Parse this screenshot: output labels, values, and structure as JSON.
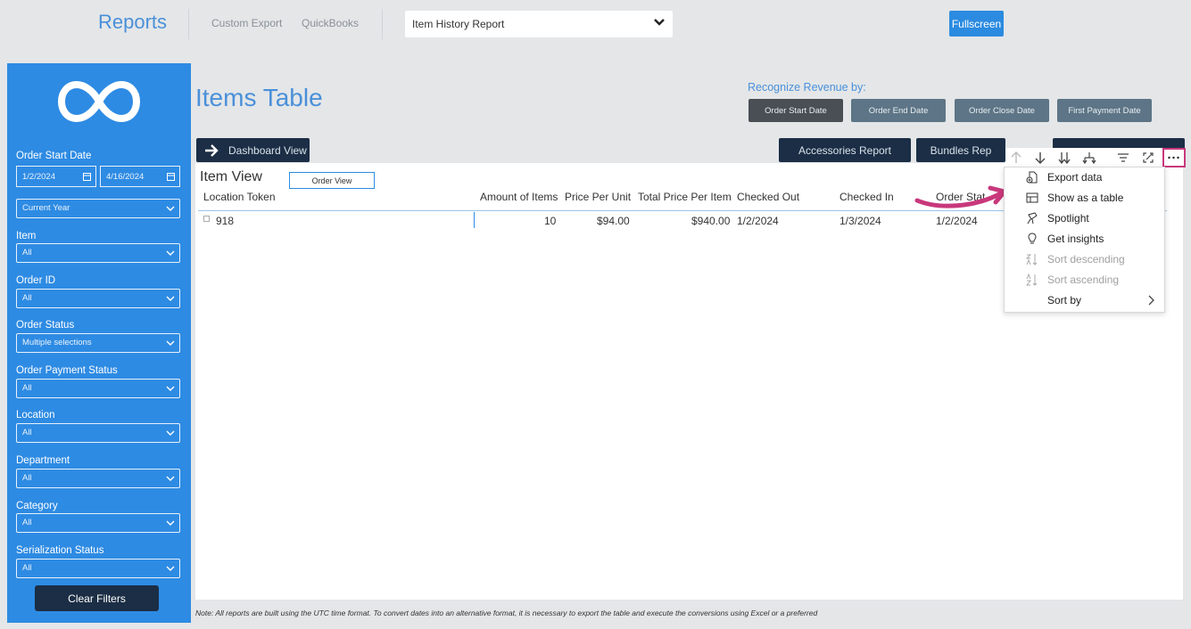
{
  "topbar": {
    "title": "Reports",
    "links": [
      "Custom Export",
      "QuickBooks"
    ],
    "report_select": "Item History Report",
    "fullscreen": "Fullscreen"
  },
  "sidebar": {
    "order_start_date": {
      "label": "Order Start Date",
      "from": "1/2/2024",
      "to": "4/16/2024",
      "period": "Current Year"
    },
    "filters": [
      {
        "label": "Item",
        "value": "All"
      },
      {
        "label": "Order ID",
        "value": "All"
      },
      {
        "label": "Order Status",
        "value": "Multiple selections"
      },
      {
        "label": "Order Payment Status",
        "value": "All"
      },
      {
        "label": "Location",
        "value": "All"
      },
      {
        "label": "Department",
        "value": "All"
      },
      {
        "label": "Category",
        "value": "All"
      },
      {
        "label": "Serialization Status",
        "value": "All"
      }
    ],
    "clear_filters": "Clear Filters"
  },
  "main": {
    "title": "Items Table",
    "recognize_label": "Recognize Revenue by:",
    "revenue_buttons": [
      "Order Start Date",
      "Order End Date",
      "Order Close Date",
      "First Payment Date"
    ],
    "dashboard_view": "Dashboard View",
    "report_buttons": [
      "Accessories Report",
      "Bundles Rep",
      ""
    ],
    "table": {
      "title": "Item View",
      "order_view": "Order View",
      "columns": [
        "Location Token",
        "Amount of Items",
        "Price Per Unit",
        "Total Price Per Item",
        "Checked Out",
        "Checked In",
        "Order Stat"
      ],
      "rows": [
        [
          "918",
          "10",
          "$94.00",
          "$940.00",
          "1/2/2024",
          "1/3/2024",
          "1/2/2024"
        ]
      ]
    },
    "note": "Note: All reports are built using the UTC time format. To convert dates into an alternative format, it is necessary to export the table and execute the conversions using Excel or a preferred"
  },
  "context_menu": {
    "items": [
      {
        "label": "Export data",
        "icon": "export-icon",
        "enabled": true
      },
      {
        "label": "Show as a table",
        "icon": "table-icon",
        "enabled": true
      },
      {
        "label": "Spotlight",
        "icon": "spotlight-icon",
        "enabled": true
      },
      {
        "label": "Get insights",
        "icon": "lightbulb-icon",
        "enabled": true
      },
      {
        "label": "Sort descending",
        "icon": "sort-descending-icon",
        "enabled": false
      },
      {
        "label": "Sort ascending",
        "icon": "sort-ascending-icon",
        "enabled": false
      },
      {
        "label": "Sort by",
        "icon": "",
        "enabled": true,
        "submenu": true
      }
    ]
  },
  "colors": {
    "accent": "#2e8be3",
    "dark_button": "#1b2e45",
    "highlight": "#c8387b"
  }
}
